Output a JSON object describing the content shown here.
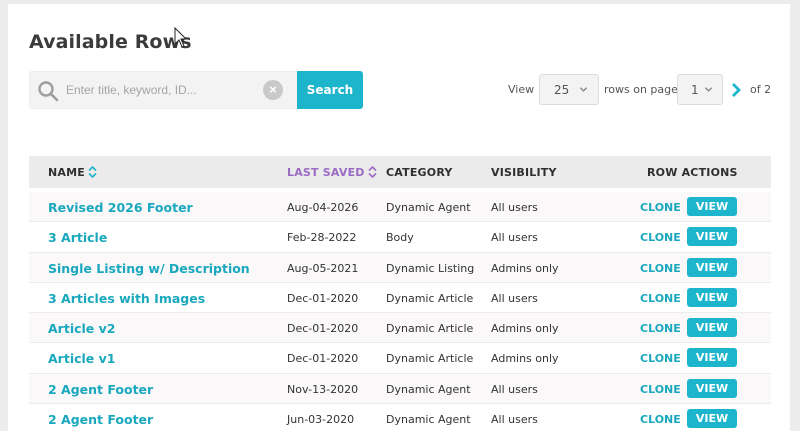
{
  "page": {
    "title": "Available Rows"
  },
  "search": {
    "placeholder": "Enter title, keyword, ID...",
    "button_label": "Search"
  },
  "pager": {
    "view_label": "View",
    "per_page": "25",
    "rows_label": "rows on page",
    "page": "1",
    "of_label": "of 2"
  },
  "table": {
    "columns": {
      "name": "NAME",
      "last_saved": "LAST SAVED",
      "category": "CATEGORY",
      "visibility": "VISIBILITY",
      "row_actions": "ROW ACTIONS"
    },
    "rows": [
      {
        "name": "Revised 2026 Footer",
        "saved": "Aug-04-2026",
        "category": "Dynamic Agent",
        "visibility": "All users"
      },
      {
        "name": "3 Article",
        "saved": "Feb-28-2022",
        "category": "Body",
        "visibility": "All users"
      },
      {
        "name": "Single Listing w/ Description",
        "saved": "Aug-05-2021",
        "category": "Dynamic Listing",
        "visibility": "Admins only"
      },
      {
        "name": "3 Articles with Images",
        "saved": "Dec-01-2020",
        "category": "Dynamic Article",
        "visibility": "All users"
      },
      {
        "name": "Article v2",
        "saved": "Dec-01-2020",
        "category": "Dynamic Article",
        "visibility": "Admins only"
      },
      {
        "name": "Article v1",
        "saved": "Dec-01-2020",
        "category": "Dynamic Article",
        "visibility": "Admins only"
      },
      {
        "name": "2 Agent Footer",
        "saved": "Nov-13-2020",
        "category": "Dynamic Agent",
        "visibility": "All users"
      },
      {
        "name": "2 Agent Footer",
        "saved": "Jun-03-2020",
        "category": "Dynamic Agent",
        "visibility": "All users"
      }
    ],
    "actions": {
      "clone_label": "CLONE",
      "view_label": "VIEW"
    }
  },
  "colors": {
    "accent": "#1cb5cc",
    "active_sort": "#9a6bc4"
  },
  "icons": {
    "search": "search-icon",
    "clear": "clear-icon",
    "chevron": "chevron-down-icon",
    "next": "chevron-right-icon",
    "sort": "sort-icon"
  }
}
